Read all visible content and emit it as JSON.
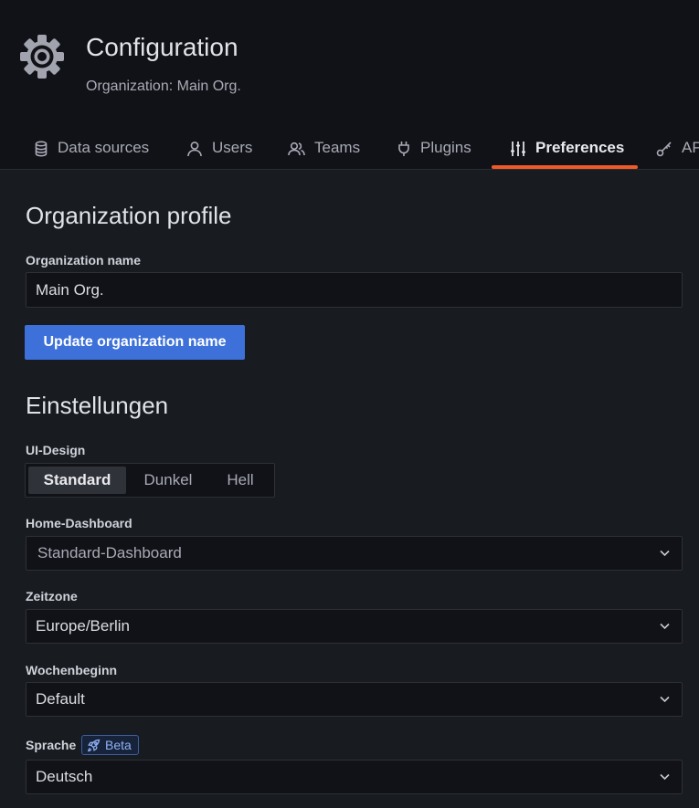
{
  "header": {
    "title": "Configuration",
    "subtitle": "Organization: Main Org.",
    "icon": "gear-icon"
  },
  "tabs": [
    {
      "label": "Data sources",
      "icon": "database-icon",
      "active": false
    },
    {
      "label": "Users",
      "icon": "user-icon",
      "active": false
    },
    {
      "label": "Teams",
      "icon": "users-icon",
      "active": false
    },
    {
      "label": "Plugins",
      "icon": "plug-icon",
      "active": false
    },
    {
      "label": "Preferences",
      "icon": "sliders-icon",
      "active": true
    },
    {
      "label": "AP",
      "icon": "key-icon",
      "active": false
    }
  ],
  "org_profile": {
    "title": "Organization profile",
    "name_label": "Organization name",
    "name_value": "Main Org.",
    "update_button": "Update organization name"
  },
  "preferences": {
    "title": "Einstellungen",
    "theme_label": "UI-Design",
    "theme_options": [
      "Standard",
      "Dunkel",
      "Hell"
    ],
    "theme_selected": "Standard",
    "home_dashboard_label": "Home-Dashboard",
    "home_dashboard_placeholder": "Standard-Dashboard",
    "timezone_label": "Zeitzone",
    "timezone_value": "Europe/Berlin",
    "week_start_label": "Wochenbeginn",
    "week_start_value": "Default",
    "language_label": "Sprache",
    "language_badge": "Beta",
    "language_value": "Deutsch"
  },
  "colors": {
    "background": "#181b1f",
    "header_background": "#111217",
    "accent_underline": "#f05a28",
    "primary_button": "#3d71d9",
    "beta_badge_text": "#8fb2f5"
  }
}
